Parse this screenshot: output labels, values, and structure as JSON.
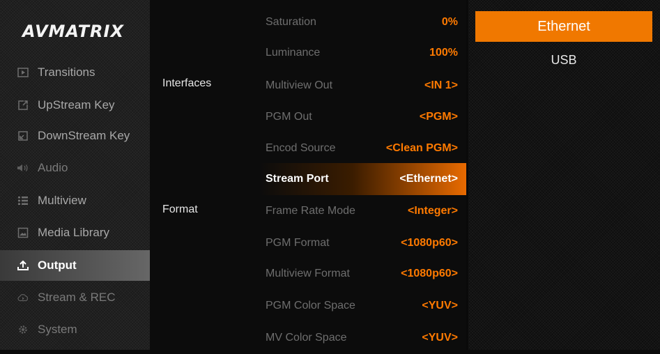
{
  "brand": {
    "logo_text": "AVMATRIX"
  },
  "sidebar": {
    "items": [
      {
        "label": "Transitions",
        "icon": "transitions-icon"
      },
      {
        "label": "UpStream Key",
        "icon": "upstream-key-icon"
      },
      {
        "label": "DownStream Key",
        "icon": "downstream-key-icon"
      },
      {
        "label": "Audio",
        "icon": "audio-icon"
      },
      {
        "label": "Multiview",
        "icon": "multiview-icon"
      },
      {
        "label": "Media Library",
        "icon": "media-library-icon"
      },
      {
        "label": "Output",
        "icon": "output-icon",
        "active": true
      },
      {
        "label": "Stream & REC",
        "icon": "stream-rec-icon"
      },
      {
        "label": "System",
        "icon": "system-icon"
      }
    ]
  },
  "categories": {
    "interfaces": "Interfaces",
    "format": "Format"
  },
  "settings": [
    {
      "label": "Saturation",
      "value": "0%"
    },
    {
      "label": "Luminance",
      "value": "100%"
    },
    {
      "label": "Multiview Out",
      "value": "<IN 1>"
    },
    {
      "label": "PGM Out",
      "value": "<PGM>"
    },
    {
      "label": "Encod Source",
      "value": "<Clean PGM>"
    },
    {
      "label": "Stream Port",
      "value": "<Ethernet>",
      "selected": true
    },
    {
      "label": "Frame Rate Mode",
      "value": "<Integer>"
    },
    {
      "label": "PGM Format",
      "value": "<1080p60>"
    },
    {
      "label": "Multiview Format",
      "value": "<1080p60>"
    },
    {
      "label": "PGM Color Space",
      "value": "<YUV>"
    },
    {
      "label": "MV Color Space",
      "value": "<YUV>"
    }
  ],
  "options": [
    {
      "label": "Ethernet",
      "selected": true
    },
    {
      "label": "USB"
    }
  ],
  "colors": {
    "accent": "#f07800",
    "value_text": "#ff7a00"
  }
}
